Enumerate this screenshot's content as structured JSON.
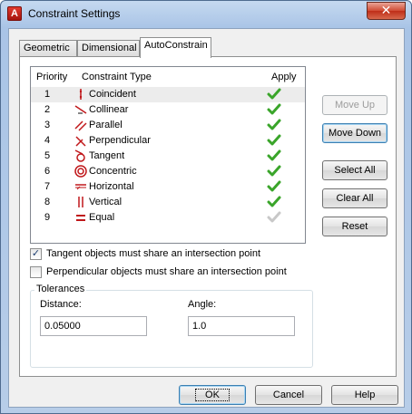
{
  "window": {
    "title": "Constraint Settings",
    "app_icon_letter": "A",
    "close_glyph": "✕"
  },
  "tabs": [
    {
      "label": "Geometric"
    },
    {
      "label": "Dimensional"
    },
    {
      "label": "AutoConstrain",
      "active": true
    }
  ],
  "table": {
    "headers": {
      "priority": "Priority",
      "type": "Constraint Type",
      "apply": "Apply"
    },
    "rows": [
      {
        "priority": "1",
        "type": "Coincident",
        "icon": "coincident-icon",
        "apply": true
      },
      {
        "priority": "2",
        "type": "Collinear",
        "icon": "collinear-icon",
        "apply": true
      },
      {
        "priority": "3",
        "type": "Parallel",
        "icon": "parallel-icon",
        "apply": true
      },
      {
        "priority": "4",
        "type": "Perpendicular",
        "icon": "perpendicular-icon",
        "apply": true
      },
      {
        "priority": "5",
        "type": "Tangent",
        "icon": "tangent-icon",
        "apply": true
      },
      {
        "priority": "6",
        "type": "Concentric",
        "icon": "concentric-icon",
        "apply": true
      },
      {
        "priority": "7",
        "type": "Horizontal",
        "icon": "horizontal-icon",
        "apply": true
      },
      {
        "priority": "8",
        "type": "Vertical",
        "icon": "vertical-icon",
        "apply": true
      },
      {
        "priority": "9",
        "type": "Equal",
        "icon": "equal-icon",
        "apply": false
      }
    ]
  },
  "side_buttons": {
    "move_up": "Move Up",
    "move_down": "Move Down",
    "select_all": "Select All",
    "clear_all": "Clear All",
    "reset": "Reset"
  },
  "options": {
    "tangent": {
      "label": "Tangent objects must share an intersection point",
      "checked": true
    },
    "perpendicular": {
      "label": "Perpendicular objects must share an intersection point",
      "checked": false
    }
  },
  "tolerances": {
    "title": "Tolerances",
    "distance_label": "Distance:",
    "distance_value": "0.05000",
    "angle_label": "Angle:",
    "angle_value": "1.0"
  },
  "footer": {
    "ok": "OK",
    "cancel": "Cancel",
    "help": "Help"
  },
  "colors": {
    "check_green": "#3aa52a",
    "accent_blue": "#3c7fb1",
    "icon_red": "#c0171a"
  }
}
